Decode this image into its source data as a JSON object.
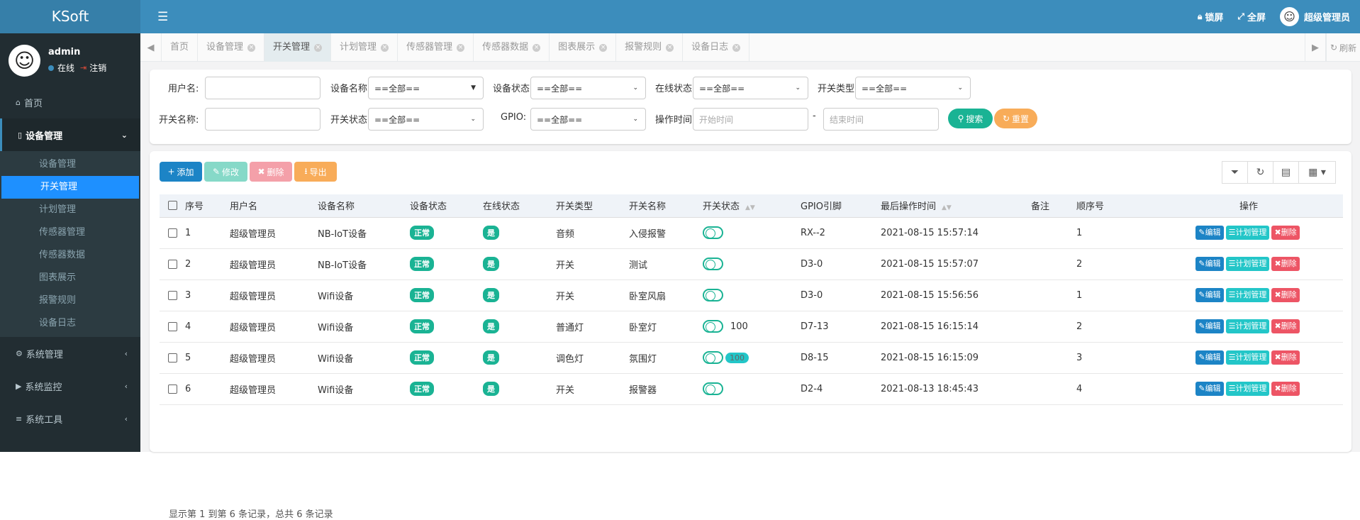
{
  "header": {
    "logo": "KSoft",
    "lock": "锁屏",
    "fullscreen": "全屏",
    "user": "超级管理员"
  },
  "sidebar": {
    "user": {
      "name": "admin",
      "online": "在线",
      "logout": "注销"
    },
    "menu": [
      {
        "label": "首页",
        "icon": "home-icon"
      },
      {
        "label": "设备管理",
        "icon": "device-icon",
        "open": true,
        "children": [
          "设备管理",
          "开关管理",
          "计划管理",
          "传感器管理",
          "传感器数据",
          "图表展示",
          "报警规则",
          "设备日志"
        ],
        "active": "开关管理"
      },
      {
        "label": "系统管理",
        "icon": "gear-icon"
      },
      {
        "label": "系统监控",
        "icon": "video-icon"
      },
      {
        "label": "系统工具",
        "icon": "list-icon"
      }
    ]
  },
  "tabs": {
    "items": [
      "首页",
      "设备管理",
      "开关管理",
      "计划管理",
      "传感器管理",
      "传感器数据",
      "图表展示",
      "报警规则",
      "设备日志"
    ],
    "active": "开关管理",
    "refresh": "刷新"
  },
  "filters": {
    "user_label": "用户名:",
    "user_value": "",
    "device_label": "设备名称:",
    "device_value": "==全部==",
    "devstate_label": "设备状态:",
    "devstate_value": "==全部==",
    "online_label": "在线状态:",
    "online_value": "==全部==",
    "swtype_label": "开关类型:",
    "swtype_value": "==全部==",
    "swname_label": "开关名称:",
    "swname_value": "",
    "swstate_label": "开关状态:",
    "swstate_value": "==全部==",
    "gpio_label": "GPIO:",
    "gpio_value": "==全部==",
    "optime_label": "操作时间:",
    "start_placeholder": "开始时间",
    "sep": "-",
    "end_placeholder": "结束时间",
    "search": "搜索",
    "reset": "重置"
  },
  "toolbar": {
    "add": "添加",
    "edit": "修改",
    "delete": "删除",
    "export": "导出"
  },
  "table": {
    "headers": [
      "序号",
      "用户名",
      "设备名称",
      "设备状态",
      "在线状态",
      "开关类型",
      "开关名称",
      "开关状态",
      "GPIO引脚",
      "最后操作时间",
      "备注",
      "顺序号",
      "操作"
    ],
    "rows": [
      {
        "no": "1",
        "user": "超级管理员",
        "device": "NB-IoT设备",
        "devstate": "正常",
        "online": "是",
        "type": "音频",
        "name": "入侵报警",
        "value": "",
        "gpio": "RX--2",
        "time": "2021-08-15 15:57:14",
        "remark": "",
        "order": "1"
      },
      {
        "no": "2",
        "user": "超级管理员",
        "device": "NB-IoT设备",
        "devstate": "正常",
        "online": "是",
        "type": "开关",
        "name": "测试",
        "value": "",
        "gpio": "D3-0",
        "time": "2021-08-15 15:57:07",
        "remark": "",
        "order": "2"
      },
      {
        "no": "3",
        "user": "超级管理员",
        "device": "Wifi设备",
        "devstate": "正常",
        "online": "是",
        "type": "开关",
        "name": "卧室风扇",
        "value": "",
        "gpio": "D3-0",
        "time": "2021-08-15 15:56:56",
        "remark": "",
        "order": "1"
      },
      {
        "no": "4",
        "user": "超级管理员",
        "device": "Wifi设备",
        "devstate": "正常",
        "online": "是",
        "type": "普通灯",
        "name": "卧室灯",
        "value": "100",
        "gpio": "D7-13",
        "time": "2021-08-15 16:15:14",
        "remark": "",
        "order": "2"
      },
      {
        "no": "5",
        "user": "超级管理员",
        "device": "Wifi设备",
        "devstate": "正常",
        "online": "是",
        "type": "调色灯",
        "name": "氛围灯",
        "value": "100",
        "valuePill": true,
        "gpio": "D8-15",
        "time": "2021-08-15 16:15:09",
        "remark": "",
        "order": "3"
      },
      {
        "no": "6",
        "user": "超级管理员",
        "device": "Wifi设备",
        "devstate": "正常",
        "online": "是",
        "type": "开关",
        "name": "报警器",
        "value": "",
        "gpio": "D2-4",
        "time": "2021-08-13 18:45:43",
        "remark": "",
        "order": "4"
      }
    ],
    "ops": {
      "edit": "编辑",
      "plan": "计划管理",
      "delete": "删除"
    },
    "footer": "显示第 1 到第 6 条记录，总共 6 条记录"
  },
  "colors": {
    "topbar": "#3c8dbc",
    "sidebar": "#222d32",
    "primary": "#1c84c6",
    "success": "#1ab394",
    "info": "#23c6c8",
    "danger": "#ed5565",
    "warning": "#f8ac59"
  }
}
